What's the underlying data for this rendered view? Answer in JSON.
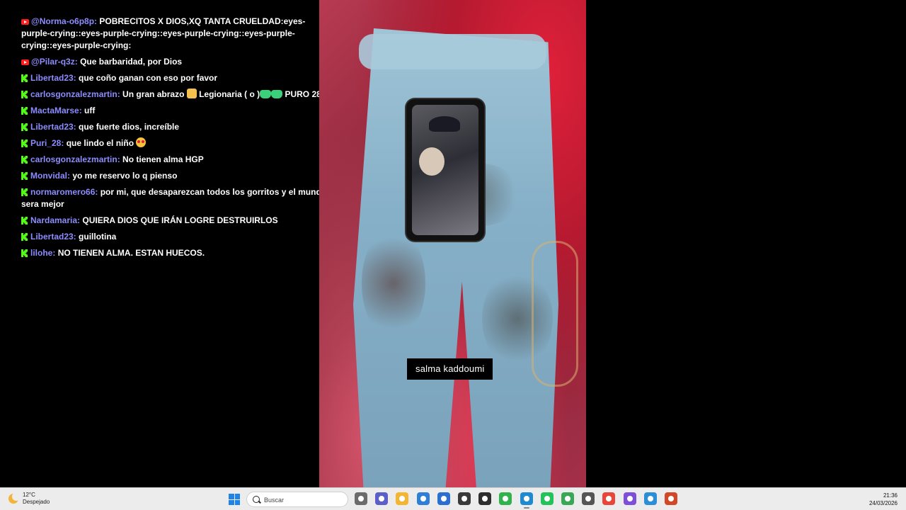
{
  "chat": [
    {
      "platform": "youtube",
      "user": "@Norma-o6p8p:",
      "text": "POBRECITOS X DIOS,XQ TANTA CRUELDAD:eyes-purple-crying::eyes-purple-crying::eyes-purple-crying::eyes-purple-crying::eyes-purple-crying:"
    },
    {
      "platform": "youtube",
      "user": "@Pilar-q3z:",
      "text": "Que barbaridad, por Dios"
    },
    {
      "platform": "kick",
      "user": "Libertad23:",
      "text": "que coño ganan con eso por favor"
    },
    {
      "platform": "kick",
      "user": "carlosgonzalezmartin:",
      "text_before": "Un gran abrazo",
      "emoji_1": "folded-hands",
      "text_middle": "Legionaria ( o )",
      "emoji_2": "kick-cats",
      "text_after": "PURO 28"
    },
    {
      "platform": "kick",
      "user": "MactaMarse:",
      "text": "uff"
    },
    {
      "platform": "kick",
      "user": "Libertad23:",
      "text": "que fuerte dios, increíble"
    },
    {
      "platform": "kick",
      "user": "Puri_28:",
      "text": "que lindo el niño",
      "emoji": "heart-eyes"
    },
    {
      "platform": "kick",
      "user": "carlosgonzalezmartin:",
      "text": "No tienen alma HGP"
    },
    {
      "platform": "kick",
      "user": "Monvidal:",
      "text": "yo me reservo lo q pienso"
    },
    {
      "platform": "kick",
      "user": "normaromero66:",
      "text": "por mi, que desaparezcan todos los gorritos y el mundo sera mejor"
    },
    {
      "platform": "kick",
      "user": "Nardamaria:",
      "text": "QUIERA DIOS QUE IRÁN LOGRE DESTRUIRLOS"
    },
    {
      "platform": "kick",
      "user": "Libertad23:",
      "text": "guillotina"
    },
    {
      "platform": "kick",
      "user": "lilohe:",
      "text": "NO TIENEN ALMA. ESTAN HUECOS."
    }
  ],
  "video": {
    "caption": "salma kaddoumi"
  },
  "taskbar": {
    "weather_temp": "12°C",
    "weather_desc": "Despejado",
    "search_placeholder": "Buscar",
    "time": "21:36",
    "date": "24/03/2026",
    "apps": [
      {
        "name": "task-view-icon",
        "color": "#6b6b6b"
      },
      {
        "name": "teams-icon",
        "color": "#5b5fc7"
      },
      {
        "name": "file-explorer-icon",
        "color": "#f2b632"
      },
      {
        "name": "microsoft-store-icon",
        "color": "#2f7fd8"
      },
      {
        "name": "mail-icon",
        "color": "#2b6fd1"
      },
      {
        "name": "recorder-icon",
        "color": "#3a3a3a"
      },
      {
        "name": "app-cube-icon",
        "color": "#2d2d2d"
      },
      {
        "name": "green-app-icon",
        "color": "#2fb34a"
      },
      {
        "name": "edge-icon",
        "color": "#1f8ad0"
      },
      {
        "name": "whatsapp-icon",
        "color": "#25c15a"
      },
      {
        "name": "chrome-profile-icon",
        "color": "#3aa757"
      },
      {
        "name": "settings-app-icon",
        "color": "#555"
      },
      {
        "name": "chrome-icon",
        "color": "#e8453c"
      },
      {
        "name": "circle-app-icon",
        "color": "#7d4ed8"
      },
      {
        "name": "earth-app-icon",
        "color": "#2c8fd6"
      },
      {
        "name": "powerpoint-icon",
        "color": "#d24726"
      }
    ]
  }
}
